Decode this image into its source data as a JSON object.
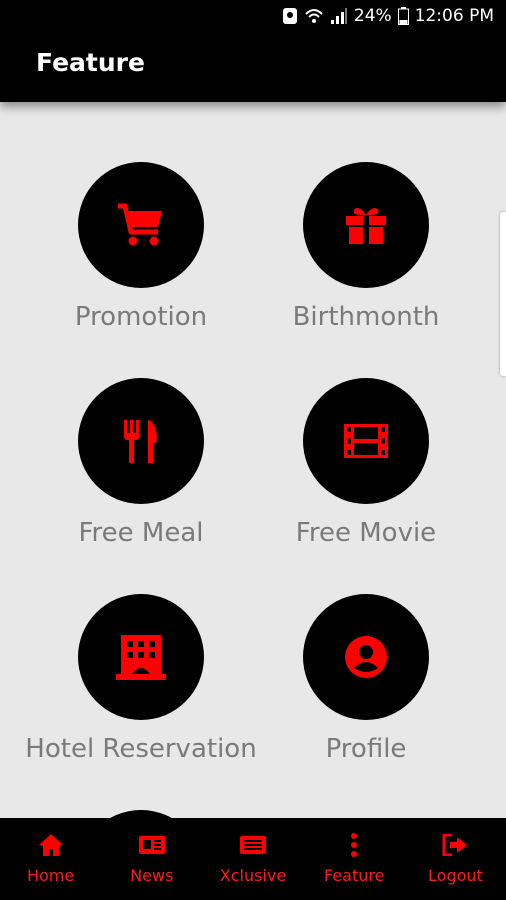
{
  "status_bar": {
    "battery": "24%",
    "time": "12:06 PM"
  },
  "app_bar": {
    "title": "Feature"
  },
  "features": [
    {
      "label": "Promotion",
      "icon": "shopping-cart-icon"
    },
    {
      "label": "Birthmonth",
      "icon": "gift-icon"
    },
    {
      "label": "Free Meal",
      "icon": "fork-knife-icon"
    },
    {
      "label": "Free Movie",
      "icon": "film-icon"
    },
    {
      "label": "Hotel Reservation",
      "icon": "hotel-icon"
    },
    {
      "label": "Profile",
      "icon": "profile-icon"
    }
  ],
  "bottom_nav": [
    {
      "label": "Home",
      "icon": "home-icon"
    },
    {
      "label": "News",
      "icon": "news-icon"
    },
    {
      "label": "Xclusive",
      "icon": "xclusive-icon"
    },
    {
      "label": "Feature",
      "icon": "more-vertical-icon"
    },
    {
      "label": "Logout",
      "icon": "logout-icon"
    }
  ],
  "colors": {
    "accent": "#ff0000",
    "bar": "#000000",
    "background": "#e8e8e8",
    "label": "#7a7a7a"
  }
}
